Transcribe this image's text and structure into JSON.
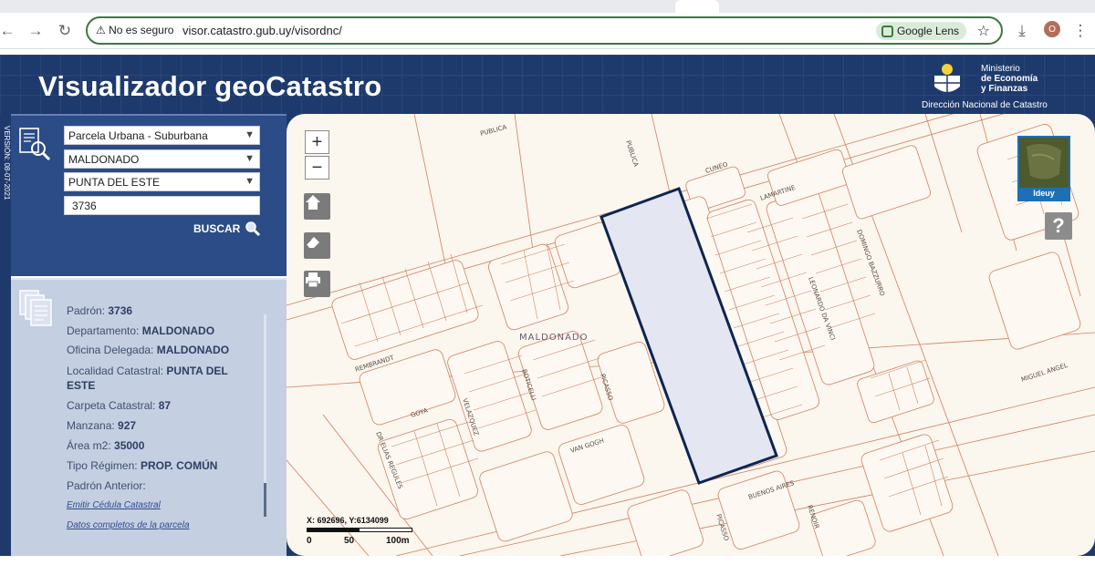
{
  "browser": {
    "security_label": "No es seguro",
    "url": "visor.catastro.gub.uy/visordnc/",
    "lens_label": "Google Lens",
    "avatar_initial": "O"
  },
  "header": {
    "title": "Visualizador geoCatastro",
    "ministry_line1": "Ministerio",
    "ministry_line2": "de Economía",
    "ministry_line3": "y Finanzas",
    "ministry_subtitle": "Dirección Nacional de Catastro"
  },
  "version_label": "VERSIÓN: 08-07-2021",
  "search": {
    "type_selected": "Parcela Urbana - Suburbana",
    "department_selected": "MALDONADO",
    "locality_selected": "PUNTA DEL ESTE",
    "padron_value": "3736",
    "button_label": "BUSCAR"
  },
  "info": {
    "padron_label": "Padrón:",
    "padron_value": "3736",
    "departamento_label": "Departamento:",
    "departamento_value": "MALDONADO",
    "oficina_label": "Oficina Delegada:",
    "oficina_value": "MALDONADO",
    "localidad_label": "Localidad Catastral:",
    "localidad_value_1": "PUNTA DEL",
    "localidad_value_2": "ESTE",
    "carpeta_label": "Carpeta Catastral:",
    "carpeta_value": "87",
    "manzana_label": "Manzana:",
    "manzana_value": "927",
    "area_label": "Área m2:",
    "area_value": "35000",
    "regimen_label": "Tipo Régimen:",
    "regimen_value": "PROP. COMÚN",
    "anterior_label": "Padrón Anterior:",
    "link_cedula": "Emitir Cédula Catastral",
    "link_completos": "Datos completos de la parcela"
  },
  "map": {
    "zoom_in": "+",
    "zoom_out": "−",
    "overview_label": "Ideuy",
    "help_label": "?",
    "coords_readout": "X: 692696, Y:6134099",
    "scale_labels": [
      "0",
      "50",
      "100m"
    ],
    "streets": {
      "publica_1": "PUBLICA",
      "publica_2": "PUBLICA",
      "cuneo": "CUNEO",
      "lamartine": "LAMARTINE",
      "domingo": "DOMINGO BAZZURRO",
      "leonardo": "LEONARDO DA VINCI",
      "maldonado": "MALDONADO",
      "rembrandt": "REMBRANDT",
      "goya": "GOYA",
      "velazquez": "VELAZQUEZ",
      "boticelli": "BOTICELLI",
      "picasso_1": "PICASSO",
      "van_gogh": "VAN GOGH",
      "elias": "DR ELIAS REGULES",
      "buenos_aires": "BUENOS AIRES",
      "picasso_2": "PICASSO",
      "renoir": "RENOIR",
      "miguel_angel": "MIGUEL ANGEL"
    },
    "colors": {
      "parcel_lines": "#cf8060",
      "highlight_fill": "#e4e6f2",
      "highlight_stroke": "#0d2550"
    }
  }
}
